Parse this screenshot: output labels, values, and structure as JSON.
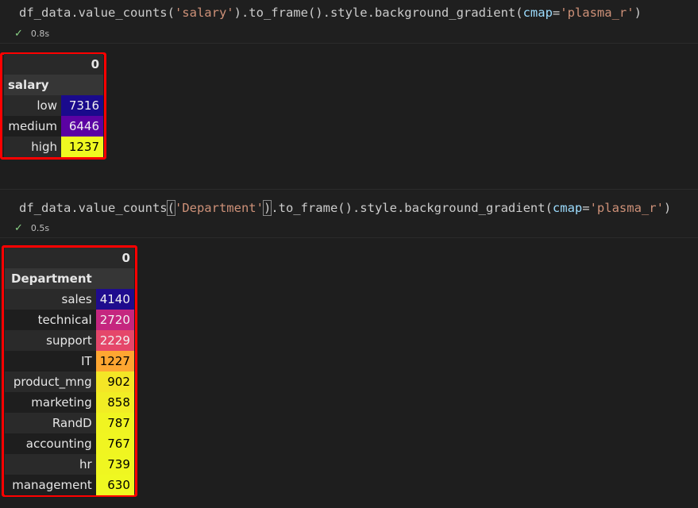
{
  "cell1": {
    "code": {
      "prefix": "df_data.value_counts(",
      "arg": "'salary'",
      "mid": ").to_frame().style.background_gradient(",
      "kw": "cmap",
      "eq": "=",
      "cmap": "'plasma_r'",
      "suffix": ")"
    },
    "status_time": "0.8s",
    "table": {
      "column_header": "0",
      "index_name": "salary",
      "rows": [
        {
          "label": "low",
          "value": "7316",
          "bg": "#1a0a8c",
          "fg": "#f1f1f1"
        },
        {
          "label": "medium",
          "value": "6446",
          "bg": "#5b02a3",
          "fg": "#f1f1f1"
        },
        {
          "label": "high",
          "value": "1237",
          "bg": "#eff821",
          "fg": "#000000"
        }
      ]
    }
  },
  "cell2": {
    "code": {
      "prefix": "df_data.value_counts",
      "open": "(",
      "arg": "'Department'",
      "close": ")",
      "mid": ".to_frame().style.background_gradient(",
      "kw": "cmap",
      "eq": "=",
      "cmap": "'plasma_r'",
      "suffix": ")"
    },
    "status_time": "0.5s",
    "table": {
      "column_header": "0",
      "index_name": "Department",
      "rows": [
        {
          "label": "sales",
          "value": "4140",
          "bg": "#1f0c8e",
          "fg": "#f1f1f1"
        },
        {
          "label": "technical",
          "value": "2720",
          "bg": "#c5267f",
          "fg": "#f1f1f1"
        },
        {
          "label": "support",
          "value": "2229",
          "bg": "#e5476a",
          "fg": "#f1f1f1"
        },
        {
          "label": "IT",
          "value": "1227",
          "bg": "#fea631",
          "fg": "#000000"
        },
        {
          "label": "product_mng",
          "value": "902",
          "bg": "#f4e626",
          "fg": "#000000"
        },
        {
          "label": "marketing",
          "value": "858",
          "bg": "#f1ed24",
          "fg": "#000000"
        },
        {
          "label": "RandD",
          "value": "787",
          "bg": "#f0f421",
          "fg": "#000000"
        },
        {
          "label": "accounting",
          "value": "767",
          "bg": "#f0f521",
          "fg": "#000000"
        },
        {
          "label": "hr",
          "value": "739",
          "bg": "#eff621",
          "fg": "#000000"
        },
        {
          "label": "management",
          "value": "630",
          "bg": "#eff821",
          "fg": "#000000"
        }
      ]
    }
  },
  "icons": {
    "success": "check-icon"
  }
}
